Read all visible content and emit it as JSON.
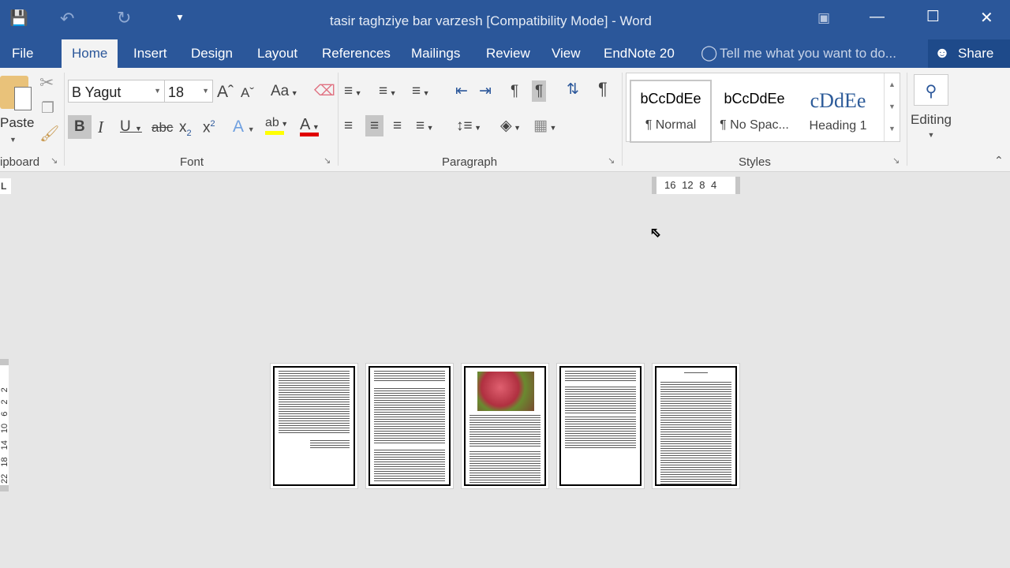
{
  "title": "tasir taghziye bar varzesh [Compatibility Mode] - Word",
  "tabs": [
    {
      "label": "File"
    },
    {
      "label": "Home"
    },
    {
      "label": "Insert"
    },
    {
      "label": "Design"
    },
    {
      "label": "Layout"
    },
    {
      "label": "References"
    },
    {
      "label": "Mailings"
    },
    {
      "label": "Review"
    },
    {
      "label": "View"
    },
    {
      "label": "EndNote 20"
    }
  ],
  "tell_me": "Tell me what you want to do...",
  "share": "Share",
  "clipboard": {
    "paste": "Paste",
    "label": "ipboard"
  },
  "font": {
    "name": "B Yagut",
    "size": "18",
    "label": "Font",
    "case": "Aa"
  },
  "paragraph": {
    "label": "Paragraph"
  },
  "styles": {
    "label": "Styles",
    "items": [
      {
        "preview": "bCcDdEe",
        "name": "¶ Normal"
      },
      {
        "preview": "bCcDdEe",
        "name": "¶ No Spac..."
      },
      {
        "preview": "cDdEe",
        "name": "Heading 1"
      }
    ]
  },
  "editing": {
    "label": "Editing"
  },
  "ruler": {
    "h": [
      "16",
      "12",
      "8",
      "4"
    ],
    "v": [
      "2",
      "2",
      "6",
      "10",
      "14",
      "18",
      "22"
    ]
  },
  "colors": {
    "accent": "#2b579a",
    "highlight": "#ffff00",
    "font_color": "#e00000"
  }
}
